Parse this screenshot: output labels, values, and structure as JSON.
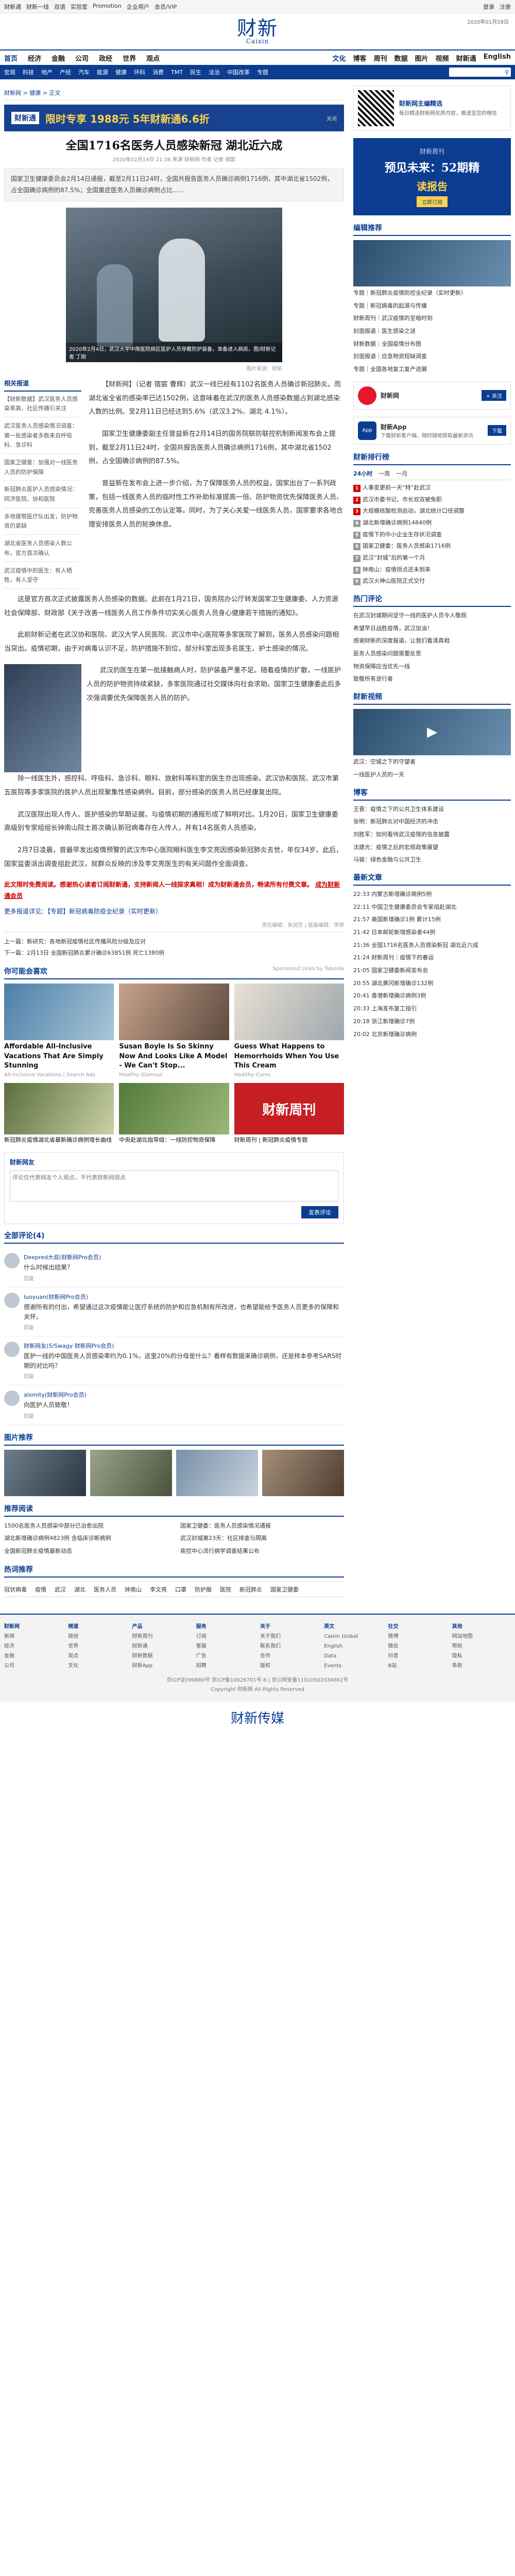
{
  "topbar": {
    "left_links": [
      "财新通",
      "财新一线",
      "双语",
      "实验室",
      "Promotion",
      "企业用户",
      "会员/VIP"
    ],
    "right_links": [
      "登录",
      "注册"
    ]
  },
  "masthead": {
    "logo": "财新",
    "logo_sub": "Caixin",
    "date": "2020年01月28日"
  },
  "nav1": {
    "items": [
      "首页",
      "经济",
      "金融",
      "公司",
      "政经",
      "世界",
      "观点",
      "文化",
      "博客",
      "周刊",
      "数据",
      "图片",
      "视频",
      "财新通",
      "English"
    ]
  },
  "nav2": {
    "items": [
      "宏观",
      "科技",
      "地产",
      "产经",
      "汽车",
      "能源",
      "健康",
      "环科",
      "消费",
      "TMT",
      "民生",
      "法治",
      "中国改革",
      "专题"
    ],
    "search_icon": "search-icon"
  },
  "breadcrumb": "财新网 > 健康 > 正文",
  "ad_banner": {
    "brand": "财新通",
    "headline": "限时专享 1988元 5年财新通6.6折",
    "close": "关闭"
  },
  "article": {
    "title": "全国1716名医务人员感染新冠 湖北近六成",
    "meta": "2020年02月14日 21:36  来源 财新网  作者 记者 宿宸",
    "summary": "国家卫生健康委员会2月14日通报，截至2月11日24时，全国共报告医务人员确诊病例1716例，其中湖北省1502例，占全国确诊病例的87.5%；全国重症医务人员确诊病例占比……",
    "photo_caption": "2020年2月4日，武汉大学中南医院病区医护人员穿戴防护装备，准备进入病房。图/财新记者 丁刚",
    "photo_credit": "图片来源：财新",
    "paragraphs": [
      "【财新网】（记者 宿宸 曹辉）武汉一线已经有1102名医务人员确诊新冠肺炎。而湖北省全省的感染率已达1502例，这意味着在武汉的医务人员感染数据占到湖北感染人数的比例。至2月11日已经达到5.6%（武汉3.2%、湖北 4.1%）。",
      "国家卫生健康委副主任曾益新在2月14日的国务院联防联控机制新闻发布会上提到，截至2月11日24时，全国共报告医务人员确诊病例1716例，其中湖北省1502例，占全国确诊病例的87.5%。",
      "曾益新在发布会上进一步介绍，为了保障医务人员的权益，国家出台了一系列政策，包括一线医务人员的临时性工作补助标准提高一倍、防护物资优先保障医务人员、完善医务人员感染的工伤认定等。同时，为了关心关爱一线医务人员，国家要求各地合理安排医务人员的轮换休息。",
      "这是官方首次正式披露医务人员感染的数据。此前在1月21日，国务院办公厅转发国家卫生健康委、人力资源社会保障部、财政部《关于改善一线医务人员工作条件切实关心医务人员身心健康若干措施的通知》。",
      "此前财新记者在武汉协和医院、武汉大学人民医院、武汉市中心医院等多家医院了解到，医务人员感染问题相当突出。疫情初期，由于对病毒认识不足，防护措施不到位，部分科室出现多名医生、护士感染的情况。",
      "武汉的医生在第一批接触病人时，防护装备严重不足。随着疫情的扩散，一线医护人员的防护物资持续紧缺，多家医院通过社交媒体向社会求助。国家卫生健康委此后多次强调要优先保障医务人员的防护。",
      "除一线医生外，感控科、呼吸科、急诊科、眼科、放射科等科室的医生亦出现感染。武汉协和医院、武汉市第五医院等多家医院的医护人员出现聚集性感染病例。目前，部分感染的医务人员已经康复出院。",
      "武汉医院出现人传人、医护感染的早期证据，与疫情初期的通报形成了鲜明对比。1月20日，国家卫生健康委高级别专家组组长钟南山院士首次确认新冠病毒存在人传人，并有14名医务人员感染。",
      "2月7日凌晨，曾最早发出疫情预警的武汉市中心医院眼科医生李文亮因感染新冠肺炎去世，年仅34岁。此后，国家监委派出调查组赴武汉，就群众反映的涉及李文亮医生的有关问题作全面调查。"
    ],
    "note": "此文限时免费阅读。感谢热心读者订阅财新通，支持新闻人一线探求真相！成为财新通会员，畅读所有付费文章。",
    "note_link": "成为财新通会员",
    "more": "更多报道详见：【专题】新冠病毒防疫全纪录（实时更新）",
    "editor": "责任编辑：张润芝 | 版面编辑：李婷"
  },
  "related": {
    "title": "相关报道",
    "items": [
      "【财新数据】武汉医务人员感染率高，社区传播引关注",
      "武汉医务人员感染情况调查：第一批感染者多数来自呼吸科、急诊科",
      "国家卫健委：加强对一线医务人员的防护保障",
      "新冠肺炎医护人员感染情况：同济医院、协和医院",
      "多地援鄂医疗队出发，防护物资仍紧缺",
      "湖北省医务人员感染人数公布，官方首次确认",
      "武汉疫情中的医生：有人牺牲，有人坚守"
    ]
  },
  "prevnext": {
    "prev": "上一篇：新研究：各地新冠疫情社区传播风险分级及应对",
    "next": "下一篇：2月13日 全国新冠肺炎累计确诊63851例 死亡1380例"
  },
  "you_may_like": {
    "title": "你可能会喜欢",
    "sponsor": "Sponsored Links by Taboola",
    "cards": [
      {
        "headline": "Affordable All-Inclusive Vacations That Are Simply Stunning",
        "source": "All-Inclusive Vacations | Search Ads"
      },
      {
        "headline": "Susan Boyle Is So Skinny Now And Looks Like A Model - We Can't Stop...",
        "source": "Healthy Glamour"
      },
      {
        "headline": "Guess What Happens to Hemorrhoids When You Use This Cream",
        "source": "Healthy Cures"
      }
    ],
    "cards2": [
      {
        "headline": "新冠肺炎疫情湖北省最新确诊病例增长曲线",
        "source": "财新网"
      },
      {
        "headline": "中央赴湖北指导组：一线防控物资保障",
        "source": "财新网"
      },
      {
        "headline": "财新周刊 | 新冠肺炎疫情专题",
        "source": "财新网"
      }
    ]
  },
  "comment": {
    "title": "财新网友",
    "placeholder": "评论仅代表网友个人观点，不代表财新网观点",
    "post_button": "发表评论",
    "count_label": "全部评论(4)",
    "items": [
      {
        "user": "Deepred大叔(财新网Pro会员)",
        "text": "什么时候出结果？",
        "action": "回复"
      },
      {
        "user": "luoyuan(财新网Pro会员)",
        "text": "感谢所有的付出，希望通过这次疫情能让医疗系统的防护和应急机制有所改进，也希望能给予医务人员更多的保障和关怀。",
        "action": "回复"
      },
      {
        "user": "财新网友(5/Swagy 财新网Pro会员)",
        "text": "医护一线的中国医务人员感染率约为0.1%，这里20%的分母是什么？看样有数据来确诊病例，还是样本参考SARS时期的对比吗？",
        "action": "回复"
      },
      {
        "user": "alxmity(财新网Pro会员)",
        "text": "向医护人员致敬！",
        "action": "回复"
      }
    ]
  },
  "gallery": {
    "title": "图片推荐",
    "count": 4
  },
  "news": {
    "title": "推荐阅读",
    "items": [
      "1500名医务人员感染中部分已治愈出院",
      "国家卫健委：医务人员感染情况通报",
      "湖北新增确诊病例4823例 含临床诊断病例",
      "武汉封城第23天：社区排查与隔离",
      "全国新冠肺炎疫情最新动态",
      "疾控中心流行病学调查结果公布"
    ]
  },
  "topics": {
    "title": "热词推荐",
    "items": [
      "冠状病毒",
      "疫情",
      "武汉",
      "湖北",
      "医务人员",
      "钟南山",
      "李文亮",
      "口罩",
      "防护服",
      "医院",
      "新冠肺炎",
      "国家卫健委"
    ]
  },
  "sidebar": {
    "qr_title": "财新网主编精选",
    "qr_desc": "每日精选财新网优质内容，推送至您的微信",
    "ad": {
      "line1": "财新周刊",
      "line2": "预见未来：52期精",
      "line3": "读报告",
      "cta": "立即订阅"
    },
    "edit_title": "编辑推荐",
    "edit_items": [
      "专题｜新冠肺炎疫情防控全纪录（实时更新）",
      "专题｜新冠病毒的起源与传播",
      "财新周刊｜武汉疫情的至暗时刻",
      "封面报道｜医生感染之谜",
      "财新数据｜全国疫情分布图",
      "封面报道｜应急物资短缺调查",
      "专题｜全国各地复工复产进展"
    ],
    "follow_name": "财新网",
    "follow_btn": "+ 关注",
    "app_name": "财新App",
    "app_desc": "下载财新客户端，随时随地获取最新资讯",
    "app_btn": "下载",
    "rank_title": "财新排行榜",
    "rank_tabs": [
      "24小时",
      "一周",
      "一月"
    ],
    "rank_items": [
      "人事变更前一天“特”赴武汉",
      "武汉市委书记、市长双双被免职",
      "大规模核酸检测启动，湖北统计口径调整",
      "湖北新增确诊病例14840例",
      "疫情下的中小企业生存状况调查",
      "国家卫健委：医务人员感染1716例",
      "武汉“封城”后的第一个月",
      "钟南山：疫情拐点还未到来",
      "武汉火神山医院正式交付"
    ],
    "hot_title": "热门评论",
    "hot_items": [
      "在武汉封城期间坚守一线的医护人员令人敬佩",
      "希望早日战胜疫情，武汉加油！",
      "感谢财新的深度报道，让我们看清真相",
      "医务人员感染问题需要反思",
      "物资保障应当优先一线",
      "致敬所有逆行者"
    ],
    "video_title": "财新视频",
    "video_items": [
      "武汉：空城之下的守望者",
      "一线医护人员的一天"
    ],
    "blog_title": "博客",
    "blog_items": [
      "王晋：疫情之下的公共卫生体系建设",
      "张明：新冠肺炎对中国经济的冲击",
      "刘胜军：如何看待武汉疫情的信息披露",
      "沈建光：疫情之后的宏观政策展望",
      "马骏：绿色金融与公共卫生"
    ],
    "latest_title": "最新文章",
    "latest_items": [
      "22:33 内蒙古新增确诊病例5例",
      "22:11 中国卫生健康委员会专家组赴湖北",
      "21:57 美国新增确诊1例 累计15例",
      "21:42 日本邮轮新增感染者44例",
      "21:36 全国1716名医务人员感染新冠 湖北近六成",
      "21:24 财新周刊｜疫情下的春运",
      "21:05 国家卫健委新闻发布会",
      "20:55 湖北黄冈新增确诊132例",
      "20:41 香港新增确诊病例3例",
      "20:33 上海发布复工指引",
      "20:18 浙江新增确诊7例",
      "20:02 北京新增确诊病例"
    ]
  },
  "footer": {
    "columns": [
      {
        "title": "财新网",
        "items": [
          "新闻",
          "经济",
          "金融",
          "公司"
        ]
      },
      {
        "title": "频道",
        "items": [
          "政经",
          "世界",
          "观点",
          "文化"
        ]
      },
      {
        "title": "产品",
        "items": [
          "财新周刊",
          "财新通",
          "财新数据",
          "财新App"
        ]
      },
      {
        "title": "服务",
        "items": [
          "订阅",
          "客服",
          "广告",
          "招聘"
        ]
      },
      {
        "title": "关于",
        "items": [
          "关于我们",
          "联系我们",
          "合作",
          "版权"
        ]
      },
      {
        "title": "英文",
        "items": [
          "Caixin Global",
          "English",
          "Data",
          "Events"
        ]
      },
      {
        "title": "社交",
        "items": [
          "微博",
          "微信",
          "抖音",
          "B站"
        ]
      },
      {
        "title": "其他",
        "items": [
          "网站地图",
          "帮助",
          "隐私",
          "条款"
        ]
      }
    ],
    "copyright": "京ICP证090880号 京ICP备10026701号-8 | 京公网安备11010502034662号",
    "copyright2": "Copyright 财新网 All Rights Reserved",
    "bottom_logo": "财新传媒"
  }
}
